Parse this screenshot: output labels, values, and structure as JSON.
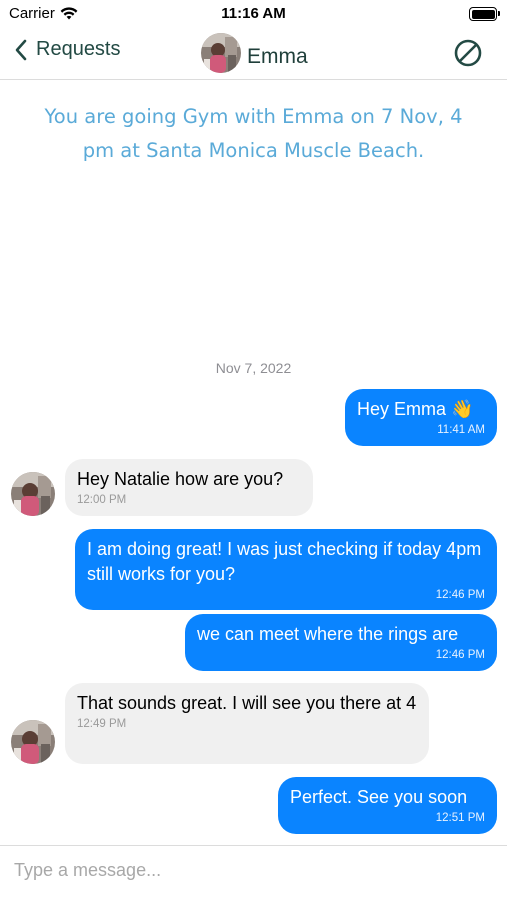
{
  "status_bar": {
    "carrier": "Carrier",
    "time": "11:16 AM"
  },
  "nav": {
    "back_label": "Requests",
    "contact_name": "Emma"
  },
  "banner": "You are going Gym with Emma on 7 Nov, 4 pm at Santa Monica Muscle Beach.",
  "date_separator": "Nov 7, 2022",
  "messages": [
    {
      "direction": "out",
      "text": "Hey Emma 👋",
      "time": "11:41 AM"
    },
    {
      "direction": "in",
      "text": "Hey Natalie how are you?",
      "time": "12:00 PM"
    },
    {
      "direction": "out",
      "text": "I am doing great! I was just checking if today 4pm still works for you?",
      "time": "12:46 PM"
    },
    {
      "direction": "out",
      "text": "we can meet where the rings are",
      "time": "12:46 PM"
    },
    {
      "direction": "in",
      "text": "That sounds great. I will see you there at 4",
      "time": "12:49 PM"
    },
    {
      "direction": "out",
      "text": "Perfect. See you soon",
      "time": "12:51 PM"
    }
  ],
  "composer": {
    "placeholder": "Type a message..."
  },
  "colors": {
    "outgoing_bubble": "#0a84ff",
    "incoming_bubble": "#f0f0f0",
    "banner_text": "#5aaad8",
    "nav_tint": "#234a44"
  }
}
